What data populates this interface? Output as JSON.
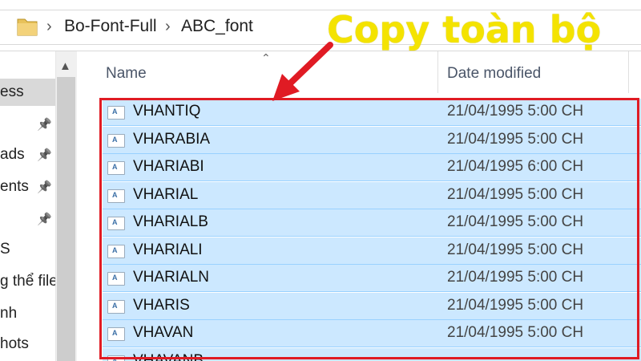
{
  "breadcrumb": {
    "items": [
      "Bo-Font-Full",
      "ABC_font"
    ],
    "separator": "›"
  },
  "columns": {
    "name": "Name",
    "date": "Date modified"
  },
  "nav": {
    "items": [
      {
        "label": "ess",
        "selected": true,
        "pinned": false
      },
      {
        "label": "",
        "selected": false,
        "pinned": true
      },
      {
        "label": "ads",
        "selected": false,
        "pinned": true
      },
      {
        "label": "ents",
        "selected": false,
        "pinned": true
      },
      {
        "label": "",
        "selected": false,
        "pinned": true
      },
      {
        "label": "S",
        "selected": false,
        "pinned": false
      },
      {
        "label": "g thể file",
        "selected": false,
        "pinned": false
      },
      {
        "label": "nh",
        "selected": false,
        "pinned": false
      },
      {
        "label": "hots",
        "selected": false,
        "pinned": false
      }
    ]
  },
  "files": [
    {
      "name": "VHANTIQ",
      "date": "21/04/1995 5:00 CH"
    },
    {
      "name": "VHARABIA",
      "date": "21/04/1995 5:00 CH"
    },
    {
      "name": "VHARIABI",
      "date": "21/04/1995 6:00 CH"
    },
    {
      "name": "VHARIAL",
      "date": "21/04/1995 5:00 CH"
    },
    {
      "name": "VHARIALB",
      "date": "21/04/1995 5:00 CH"
    },
    {
      "name": "VHARIALI",
      "date": "21/04/1995 5:00 CH"
    },
    {
      "name": "VHARIALN",
      "date": "21/04/1995 5:00 CH"
    },
    {
      "name": "VHARIS",
      "date": "21/04/1995 5:00 CH"
    },
    {
      "name": "VHAVAN",
      "date": "21/04/1995 5:00 CH"
    },
    {
      "name": "VHAVANB",
      "date": ""
    }
  ],
  "annotation": {
    "text": "Copy toàn bộ",
    "color": "#f4e300",
    "arrow_color": "#e01b24"
  },
  "colors": {
    "selection": "#cce8ff",
    "highlight_border": "#e01b24"
  },
  "icons": {
    "folder": "folder-icon",
    "file": "font-file-icon",
    "pin": "pin-icon",
    "sort": "sort-caret-icon"
  }
}
